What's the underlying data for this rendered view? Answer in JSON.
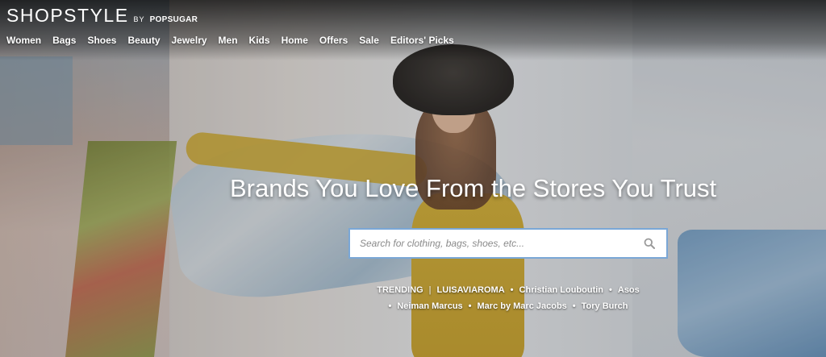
{
  "brand": {
    "name": "SHOPSTYLE",
    "by": "BY",
    "partner": "POPSUGAR"
  },
  "nav": {
    "items": [
      "Women",
      "Bags",
      "Shoes",
      "Beauty",
      "Jewelry",
      "Men",
      "Kids",
      "Home",
      "Offers",
      "Sale",
      "Editors' Picks"
    ]
  },
  "hero": {
    "headline": "Brands You Love From the Stores You Trust"
  },
  "search": {
    "placeholder": "Search for clothing, bags, shoes, etc...",
    "value": "",
    "icon": "search-icon"
  },
  "trending": {
    "label": "TRENDING",
    "separator": "|",
    "row1": [
      "LUISAVIAROMA",
      "Christian Louboutin",
      "Asos"
    ],
    "row2": [
      "Neiman Marcus",
      "Marc by Marc Jacobs",
      "Tory Burch"
    ]
  },
  "colors": {
    "text": "#ffffff",
    "search_border": "#7aa7d6"
  }
}
